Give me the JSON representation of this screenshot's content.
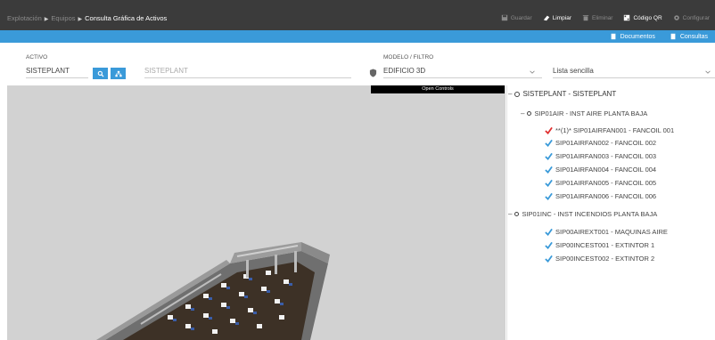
{
  "breadcrumb": {
    "items": [
      "Explotación",
      "Equipos"
    ],
    "current": "Consulta Gráfica de Activos"
  },
  "toolbar": {
    "guardar": "Guardar",
    "limpiar": "Limpiar",
    "eliminar": "Eliminar",
    "codigo_qr": "Código QR",
    "configurar": "Configurar"
  },
  "bluebar": {
    "documentos": "Documentos",
    "consultas": "Consultas"
  },
  "form": {
    "activo_label": "ACTIVO",
    "activo_value": "SISTEPLANT",
    "activo_desc": "SISTEPLANT",
    "modelo_label": "MODELO / FILTRO",
    "modelo_value": "EDIFICIO 3D",
    "lista_value": "Lista sencilla"
  },
  "viewport": {
    "open_controls": "Open Controls"
  },
  "tree": {
    "root": "SISTEPLANT - SISTEPLANT",
    "groups": [
      {
        "label": "SIP01AIR - INST AIRE PLANTA BAJA",
        "items": [
          "**(1)* SIP01AIRFAN001 - FANCOIL 001",
          "SIP01AIRFAN002 - FANCOIL 002",
          "SIP01AIRFAN003 - FANCOIL 003",
          "SIP01AIRFAN004 - FANCOIL 004",
          "SIP01AIRFAN005 - FANCOIL 005",
          "SIP01AIRFAN006 - FANCOIL 006"
        ]
      },
      {
        "label": "SIP01INC - INST INCENDIOS PLANTA BAJA",
        "items": [
          "SIP00AIREXT001 - MAQUINAS AIRE",
          "SIP00INCEST001 - EXTINTOR 1",
          "SIP00INCEST002 - EXTINTOR 2"
        ]
      }
    ]
  },
  "colors": {
    "topbar": "#3b3b3b",
    "accent_blue": "#3a9ad9",
    "check_blue": "#3a9ad9",
    "check_red": "#e03030",
    "viewport_bg": "#d2d2d2"
  }
}
